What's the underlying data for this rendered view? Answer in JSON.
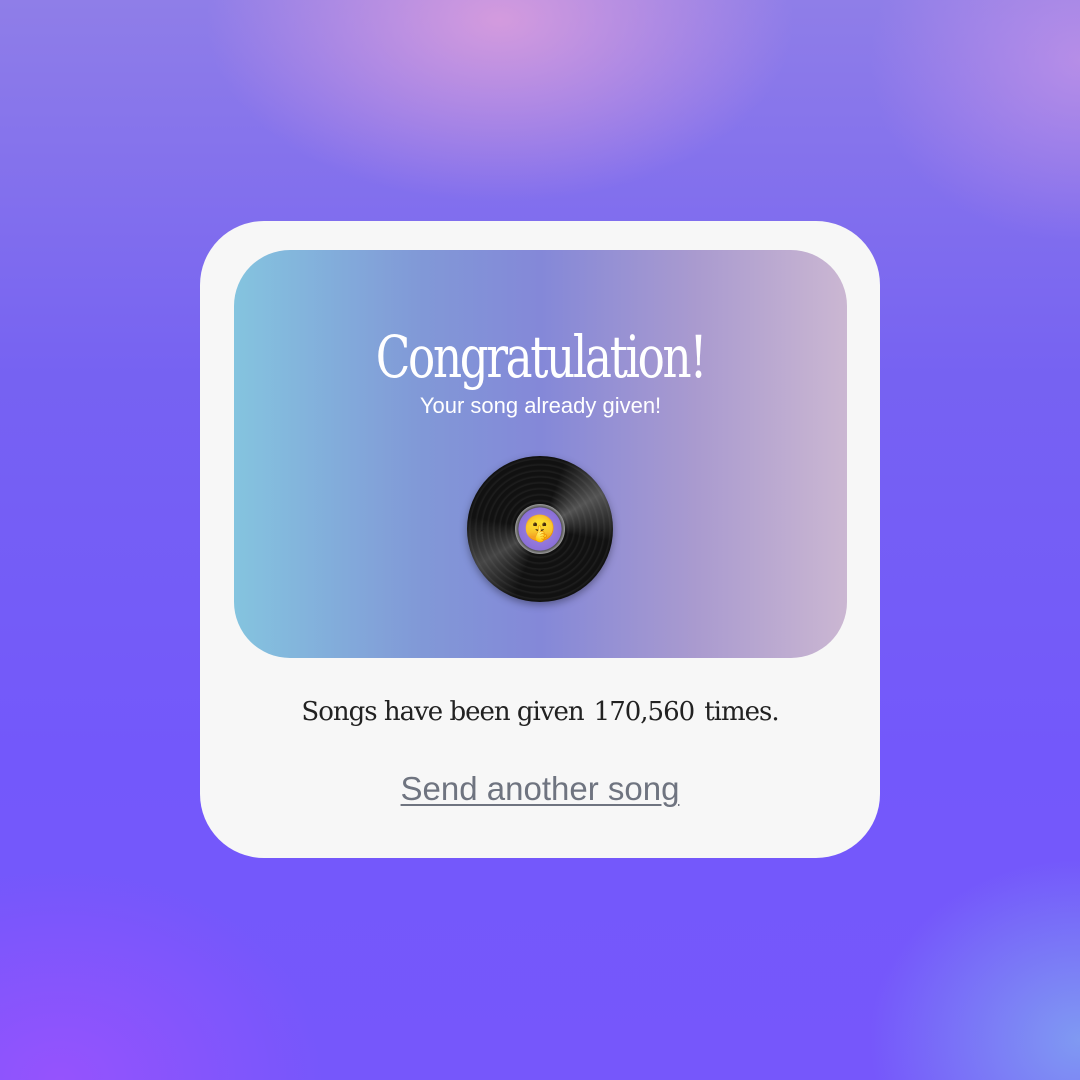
{
  "card": {
    "title": "Congratulation!",
    "subtitle": "Your song already given!",
    "record_emoji": "🤫",
    "record_icon": "vinyl-record-icon",
    "count_prefix": "Songs have been given",
    "count_value": "170,560",
    "count_suffix": "times.",
    "send_link": "Send another song"
  },
  "colors": {
    "banner_start": "#84c4df",
    "banner_mid": "#8488d8",
    "banner_end": "#cbb7d2",
    "card_bg": "#f7f7f7",
    "link": "#6f7480"
  }
}
